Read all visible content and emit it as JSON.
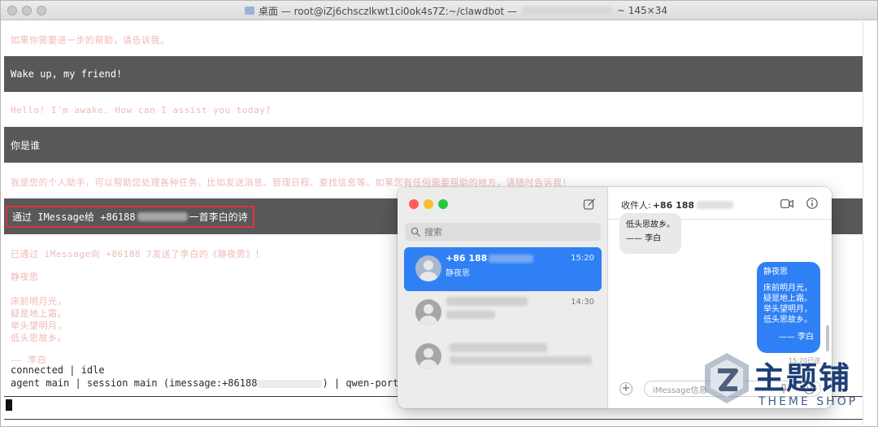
{
  "terminal": {
    "title_prefix": "桌面 — root@iZj6chsczlkwt1ci0ok4s7Z:~/clawdbot —",
    "title_suffix": "~ 145×34",
    "faint_line_1": "如果你需要进一步的帮助，请告诉我。",
    "band_1": "Wake up, my friend!",
    "faint_line_2": "Hello! I'm awake. How can I assist you today?",
    "band_2": "你是谁",
    "faint_line_3": "我是您的个人助手，可以帮助您处理各种任务，比如发送消息、管理日程、查找信息等。如果您有任何需要帮助的地方，请随时告诉我！",
    "band_3_prefix": "通过 IMessage给 +86188",
    "band_3_suffix": "一首李白的诗",
    "faint_line_4": "已通过 iMessage向 +86188    7发送了李白的《静夜思》！",
    "faint_poem": [
      "静夜思",
      "床前明月光，",
      "疑是地上霜。",
      "举头望明月，",
      "低头思故乡。",
      "—— 李白"
    ],
    "status_1": "connected | idle",
    "status_2_prefix": "agent main | session main (imessage:+86188",
    "status_2_suffix": ") | qwen-portal/"
  },
  "messages": {
    "search_placeholder": "搜索",
    "conversations": [
      {
        "name": "+86 188",
        "preview": "静夜思",
        "time": "15:20"
      },
      {
        "name": "",
        "preview": "",
        "time": "14:30"
      },
      {
        "name": "",
        "preview": "",
        "time": ""
      }
    ],
    "header": {
      "recipient_label": "收件人:",
      "recipient_number": "+86 188"
    },
    "incoming": {
      "line_1": "低头思故乡。",
      "line_2": "—— 李白"
    },
    "outgoing": {
      "title": "静夜思",
      "lines": [
        "床前明月光，",
        "疑是地上霜。",
        "举头望明月，",
        "低头思故乡。"
      ],
      "signature": "—— 李白"
    },
    "delivered": "15:20已送",
    "input_placeholder": "iMessage信息"
  },
  "watermark": {
    "cn": "主题铺",
    "en": "THEME SHOP"
  },
  "colors": {
    "band": "#585858",
    "highlight": "#e0333a",
    "imessage_blue": "#2f80f5",
    "faint_text": "#f1b8b8"
  }
}
